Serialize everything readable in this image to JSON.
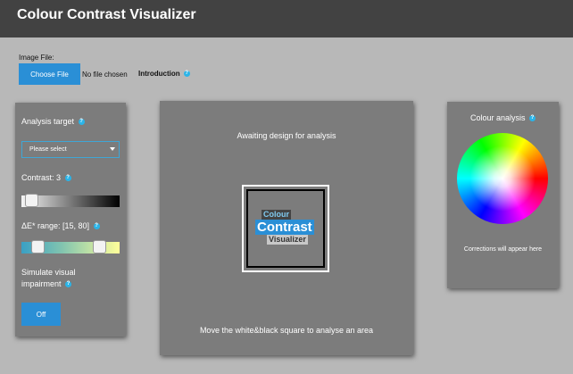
{
  "app": {
    "title": "Colour Contrast Visualizer"
  },
  "file": {
    "label": "Image File:",
    "button_label": "Choose File",
    "status": "No file chosen"
  },
  "intro": {
    "label": "Introduction",
    "help_glyph": "?"
  },
  "left_panel": {
    "analysis_label": "Analysis target",
    "select_value": "Please select",
    "contrast_label": "Contrast: 3",
    "contrast_value": 3,
    "de_label": "ΔE* range: [15, 80]",
    "de_range": [
      15,
      80
    ],
    "simulate_line1": "Simulate visual",
    "simulate_line2": "impairment",
    "off_label": "Off",
    "help_glyph": "?"
  },
  "center_panel": {
    "status": "Awaiting design for analysis",
    "instruction": "Move the white&black square to analyse an area",
    "logo": {
      "word1": "Colour",
      "word2": "Contrast",
      "word3": "Visualizer"
    }
  },
  "right_panel": {
    "title": "Colour analysis",
    "corrections": "Corrections will appear here",
    "help_glyph": "?"
  },
  "colors": {
    "topbar": "#424242",
    "page_bg": "#b8b8b8",
    "panel_bg": "#7c7c7c",
    "accent": "#2a8fd6",
    "help_badge": "#2ab4e8"
  }
}
